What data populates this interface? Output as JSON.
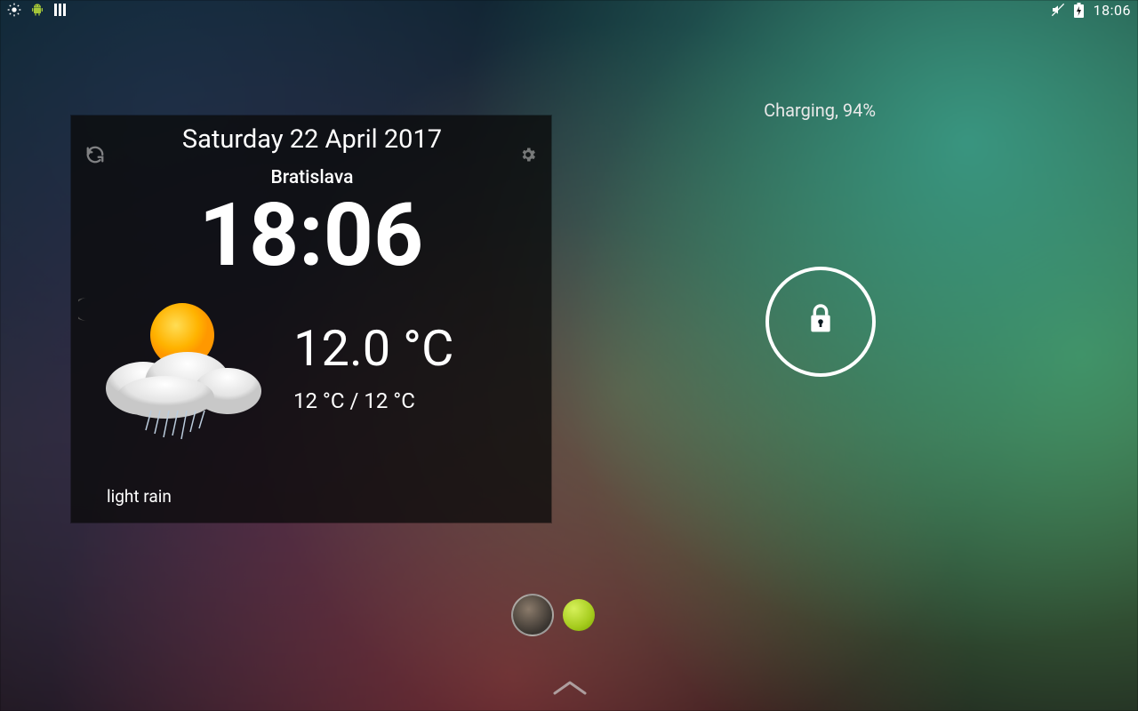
{
  "status_bar": {
    "clock": "18:06",
    "icons": {
      "brightness": "brightness-icon",
      "android": "android-icon",
      "bars": "bars-icon",
      "mute": "mute-icon",
      "battery": "battery-charging-icon"
    }
  },
  "charging_text": "Charging, 94%",
  "widget": {
    "date": "Saturday 22 April 2017",
    "city": "Bratislava",
    "time": "18:06",
    "temperature": "12.0 °C",
    "min_max": "12 °C / 12 °C",
    "condition": "light rain"
  },
  "lock": {
    "label": "lock"
  }
}
